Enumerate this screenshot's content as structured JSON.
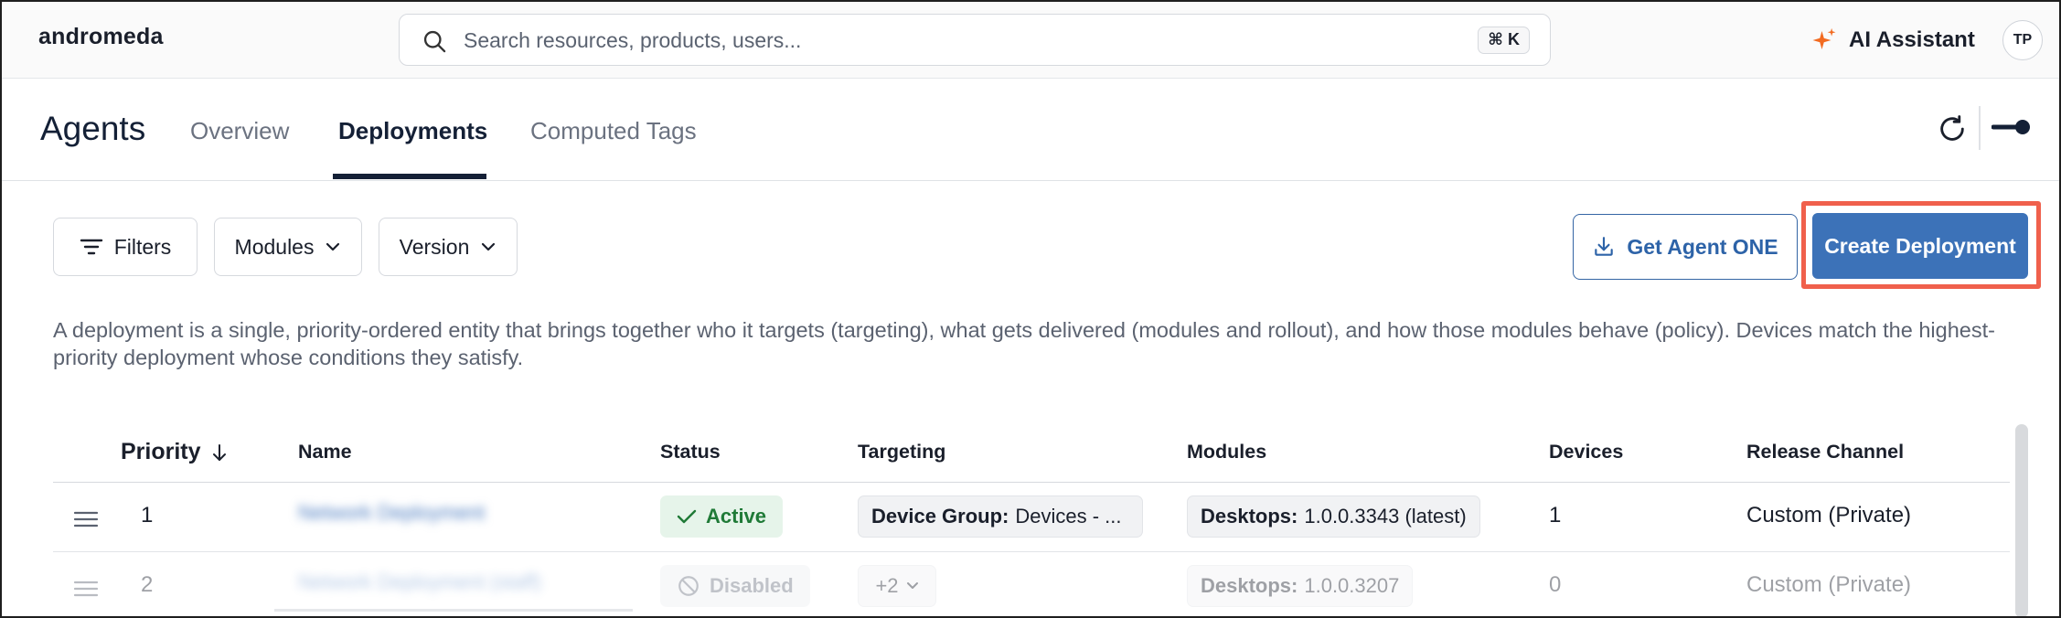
{
  "topbar": {
    "brand": "andromeda",
    "search_placeholder": "Search resources, products, users...",
    "shortcut": "⌘ K",
    "ai_label": "AI Assistant",
    "avatar_initials": "TP"
  },
  "subheader": {
    "title": "Agents",
    "tabs": [
      {
        "label": "Overview",
        "active": false
      },
      {
        "label": "Deployments",
        "active": true
      },
      {
        "label": "Computed Tags",
        "active": false
      }
    ]
  },
  "toolbar": {
    "filters_label": "Filters",
    "modules_label": "Modules",
    "version_label": "Version",
    "get_agent_label": "Get Agent ONE",
    "create_label": "Create Deployment"
  },
  "description": "A deployment is a single, priority-ordered entity that brings together who it targets (targeting), what gets delivered (modules and rollout), and how those modules behave (policy). Devices match the highest-priority deployment whose conditions they satisfy.",
  "table": {
    "columns": [
      "Priority",
      "Name",
      "Status",
      "Targeting",
      "Modules",
      "Devices",
      "Release Channel"
    ],
    "rows": [
      {
        "priority": "1",
        "name": "Network Deployment",
        "status": "Active",
        "targeting_key": "Device Group:",
        "targeting_value": "Devices - ...",
        "module_key": "Desktops:",
        "module_value": "1.0.0.3343 (latest)",
        "devices": "1",
        "channel": "Custom (Private)"
      },
      {
        "priority": "2",
        "name": "Network Deployment (staff)",
        "status": "Disabled",
        "targeting_more": "+2",
        "module_key": "Desktops:",
        "module_value": "1.0.0.3207",
        "devices": "0",
        "channel": "Custom (Private)"
      }
    ]
  },
  "colors": {
    "primary": "#3c72b8",
    "highlight": "#f0604c",
    "active_bg": "#e6f4ea",
    "active_fg": "#1f7a37",
    "ai_spark": "#f26b21"
  }
}
